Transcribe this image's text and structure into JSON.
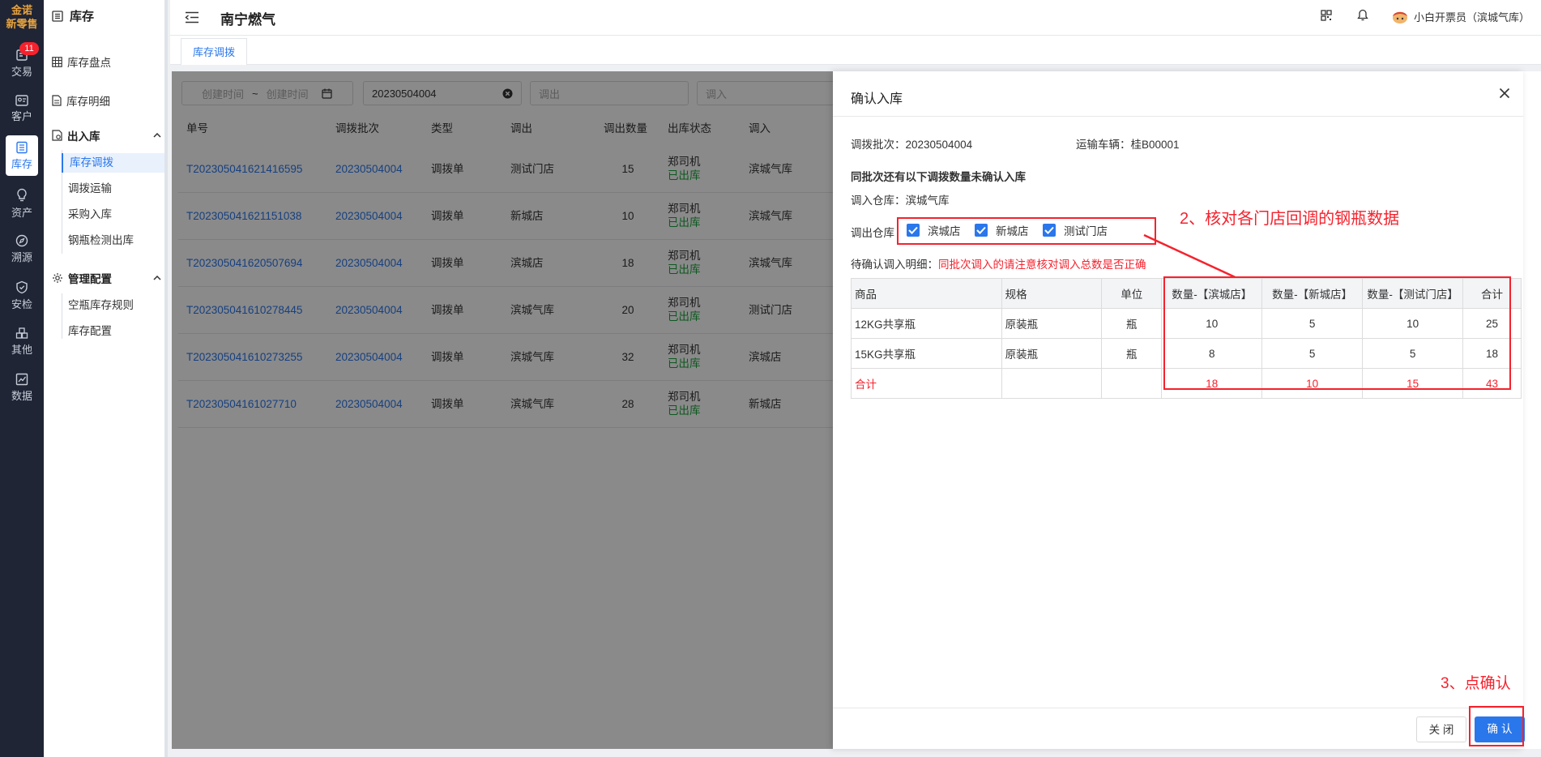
{
  "brand": {
    "line1": "金诺",
    "line2": "新零售"
  },
  "leftnav": {
    "items": [
      {
        "label": "交易",
        "icon": "trade-icon",
        "badge": "11"
      },
      {
        "label": "客户",
        "icon": "customer-icon"
      },
      {
        "label": "库存",
        "icon": "inventory-icon",
        "active": true
      },
      {
        "label": "资产",
        "icon": "asset-icon"
      },
      {
        "label": "溯源",
        "icon": "trace-icon"
      },
      {
        "label": "安检",
        "icon": "safety-check-icon"
      },
      {
        "label": "其他",
        "icon": "other-icon"
      },
      {
        "label": "数据",
        "icon": "data-icon"
      }
    ]
  },
  "sidemenu": {
    "title": "库存",
    "items": [
      "库存盘点",
      "库存明细"
    ],
    "group1": {
      "label": "出入库",
      "subs": [
        "库存调拨",
        "调拨运输",
        "采购入库",
        "钢瓶检测出库"
      ]
    },
    "group2": {
      "label": "管理配置",
      "subs": [
        "空瓶库存规则",
        "库存配置"
      ]
    }
  },
  "header": {
    "title": "南宁燃气",
    "user": "小白开票员（滨城气库）"
  },
  "tabs": [
    "库存调拨"
  ],
  "filters": {
    "start_ph": "创建时间",
    "sep": "~",
    "end_ph": "创建时间",
    "batch_value": "20230504004",
    "out_ph": "调出",
    "in_ph": "调入"
  },
  "table": {
    "headers": [
      "单号",
      "调拨批次",
      "类型",
      "调出",
      "调出数量",
      "出库状态",
      "调入"
    ],
    "rows": [
      {
        "no": "T202305041621416595",
        "batch": "20230504004",
        "type": "调拨单",
        "out": "测试门店",
        "qty": "15",
        "driver": "郑司机",
        "status": "已出库",
        "in": "滨城气库"
      },
      {
        "no": "T202305041621151038",
        "batch": "20230504004",
        "type": "调拨单",
        "out": "新城店",
        "qty": "10",
        "driver": "郑司机",
        "status": "已出库",
        "in": "滨城气库"
      },
      {
        "no": "T202305041620507694",
        "batch": "20230504004",
        "type": "调拨单",
        "out": "滨城店",
        "qty": "18",
        "driver": "郑司机",
        "status": "已出库",
        "in": "滨城气库"
      },
      {
        "no": "T202305041610278445",
        "batch": "20230504004",
        "type": "调拨单",
        "out": "滨城气库",
        "qty": "20",
        "driver": "郑司机",
        "status": "已出库",
        "in": "测试门店"
      },
      {
        "no": "T202305041610273255",
        "batch": "20230504004",
        "type": "调拨单",
        "out": "滨城气库",
        "qty": "32",
        "driver": "郑司机",
        "status": "已出库",
        "in": "滨城店"
      },
      {
        "no": "T20230504161027710",
        "batch": "20230504004",
        "type": "调拨单",
        "out": "滨城气库",
        "qty": "28",
        "driver": "郑司机",
        "status": "已出库",
        "in": "新城店"
      }
    ]
  },
  "modal": {
    "title": "确认入库",
    "batch_label": "调拨批次：",
    "batch_value": "20230504004",
    "vehicle_label": "运输车辆：",
    "vehicle_value": "桂B00001",
    "notice": "同批次还有以下调拨数量未确认入库",
    "in_wh_label": "调入仓库：",
    "in_wh_value": "滨城气库",
    "out_wh_label": "调出仓库",
    "checkboxes": [
      "滨城店",
      "新城店",
      "测试门店"
    ],
    "detail_label": "待确认调入明细：",
    "detail_warning": "同批次调入的请注意核对调入总数是否正确",
    "detail_headers": [
      "商品",
      "规格",
      "单位",
      "数量-【滨城店】",
      "数量-【新城店】",
      "数量-【测试门店】",
      "合计"
    ],
    "detail_rows": [
      [
        "12KG共享瓶",
        "原装瓶",
        "瓶",
        "10",
        "5",
        "10",
        "25"
      ],
      [
        "15KG共享瓶",
        "原装瓶",
        "瓶",
        "8",
        "5",
        "5",
        "18"
      ]
    ],
    "total_row": [
      "合计",
      "",
      "",
      "18",
      "10",
      "15",
      "43"
    ],
    "annotation2": "2、核对各门店回调的钢瓶数据",
    "annotation3": "3、点确认",
    "close_label": "关 闭",
    "ok_label": "确认"
  },
  "colors": {
    "primary": "#2a77ec",
    "danger": "#f5222d",
    "success": "#19a33a",
    "nav_bg": "#1f2535",
    "brand": "#e8a33d"
  }
}
